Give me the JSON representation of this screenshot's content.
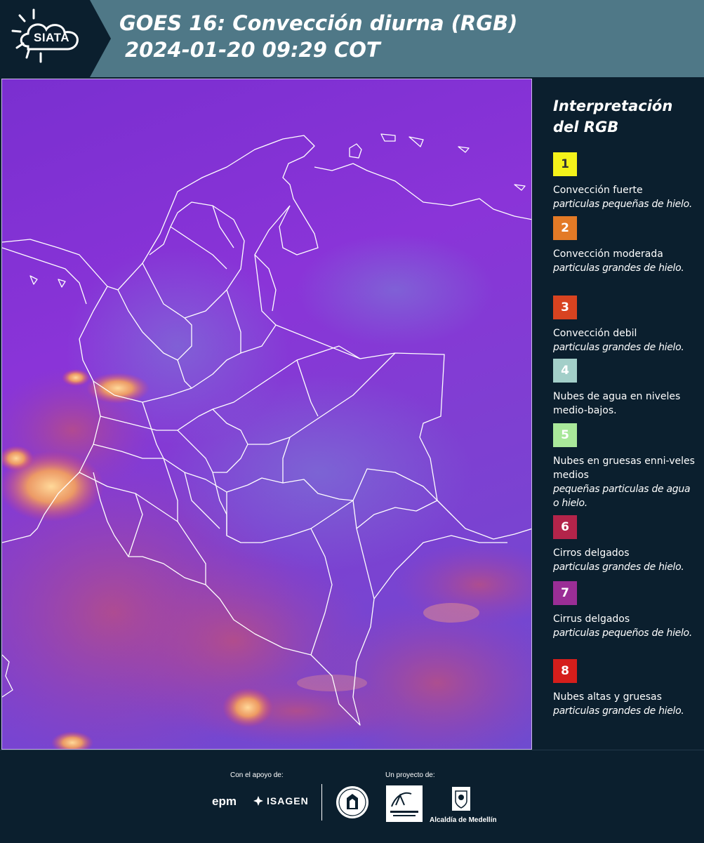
{
  "header": {
    "logo_text": "SIATA",
    "title_line1": "GOES 16: Convección diurna (RGB)",
    "title_line2": "2024-01-20 09:29 COT"
  },
  "colors": {
    "header_bg": "#4f7887",
    "page_bg": "#0b1f2e",
    "map_bg": "#8a34d8",
    "border_lines": "#ffffff"
  },
  "legend": {
    "title": "Interpretación del RGB",
    "items": [
      {
        "number": "1",
        "color": "#f4f21a",
        "text_color": "#333333",
        "label": "Convección fuerte",
        "sub": "particulas pequeñas de hielo."
      },
      {
        "number": "2",
        "color": "#e37a26",
        "text_color": "#ffffff",
        "label": "Convección moderada",
        "sub": "particulas grandes de hielo."
      },
      {
        "number": "3",
        "color": "#d84320",
        "text_color": "#ffffff",
        "label": "Convección debil",
        "sub": "particulas grandes de hielo."
      },
      {
        "number": "4",
        "color": "#a3cfc9",
        "text_color": "#ffffff",
        "label": "Nubes de agua en niveles medio-bajos.",
        "sub": ""
      },
      {
        "number": "5",
        "color": "#a9e89a",
        "text_color": "#ffffff",
        "label": "Nubes en gruesas enni-veles medios",
        "sub": "pequeñas particulas de agua o hielo."
      },
      {
        "number": "6",
        "color": "#b3244a",
        "text_color": "#ffffff",
        "label": "Cirros delgados",
        "sub": "particulas grandes de hielo."
      },
      {
        "number": "7",
        "color": "#9a2e96",
        "text_color": "#ffffff",
        "label": "Cirrus delgados",
        "sub": "particulas pequeños de hielo."
      },
      {
        "number": "8",
        "color": "#d51e1b",
        "text_color": "#ffffff",
        "label": "Nubes altas y gruesas",
        "sub": "particulas grandes de hielo."
      }
    ]
  },
  "footer": {
    "support_label": "Con el apoyo de:",
    "project_label": "Un proyecto de:",
    "sponsors": [
      "epm",
      "ISAGEN"
    ],
    "partners": [
      "Área Metropolitana Valle de Aburrá",
      "Alcaldía de Medellín"
    ],
    "medellin_text": "Alcaldía de Medellín"
  }
}
